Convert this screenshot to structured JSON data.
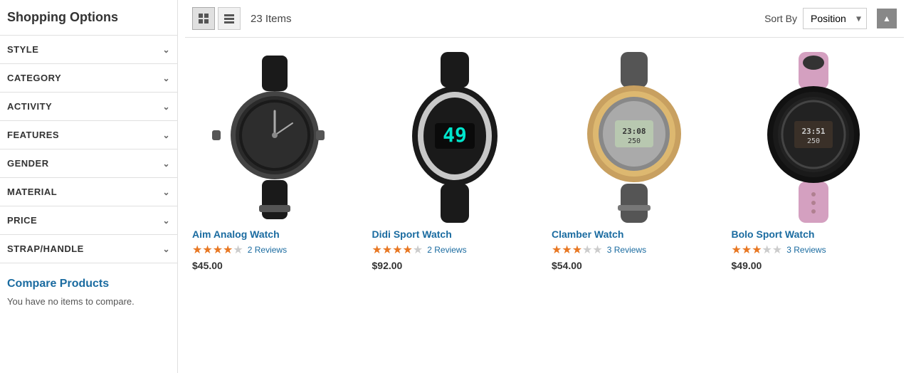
{
  "sidebar": {
    "title": "Shopping Options",
    "filters": [
      {
        "label": "STYLE"
      },
      {
        "label": "CATEGORY"
      },
      {
        "label": "ACTIVITY"
      },
      {
        "label": "FEATURES"
      },
      {
        "label": "GENDER"
      },
      {
        "label": "MATERIAL"
      },
      {
        "label": "PRICE"
      },
      {
        "label": "STRAP/HANDLE"
      }
    ],
    "compare_title_static": "Compare ",
    "compare_title_link": "Products",
    "compare_note": "You have no items to compare."
  },
  "toolbar": {
    "item_count": "23 Items",
    "sort_label": "Sort By",
    "sort_value": "Position"
  },
  "products": [
    {
      "id": "aim-analog",
      "name": "Aim Analog Watch",
      "stars_filled": 4,
      "stars_empty": 1,
      "reviews_count": "2 Reviews",
      "price": "$45.00",
      "watch_color": "#2a2a2a",
      "band_color": "#1a1a1a",
      "watch_type": "analog"
    },
    {
      "id": "didi-sport",
      "name": "Didi Sport Watch",
      "stars_filled": 4,
      "stars_empty": 1,
      "reviews_count": "2 Reviews",
      "price": "$92.00",
      "watch_color": "#c0c0c0",
      "band_color": "#1a1a1a",
      "watch_type": "digital-oval"
    },
    {
      "id": "clamber",
      "name": "Clamber Watch",
      "stars_filled": 3,
      "stars_empty": 2,
      "reviews_count": "3 Reviews",
      "price": "$54.00",
      "watch_color": "#b8a070",
      "band_color": "#555",
      "watch_type": "digital-round"
    },
    {
      "id": "bolo-sport",
      "name": "Bolo Sport Watch",
      "stars_filled": 3,
      "stars_empty": 2,
      "reviews_count": "3 Reviews",
      "price": "$49.00",
      "watch_color": "#2a2a2a",
      "band_color": "#d4a0c0",
      "watch_type": "digital-dark"
    }
  ]
}
